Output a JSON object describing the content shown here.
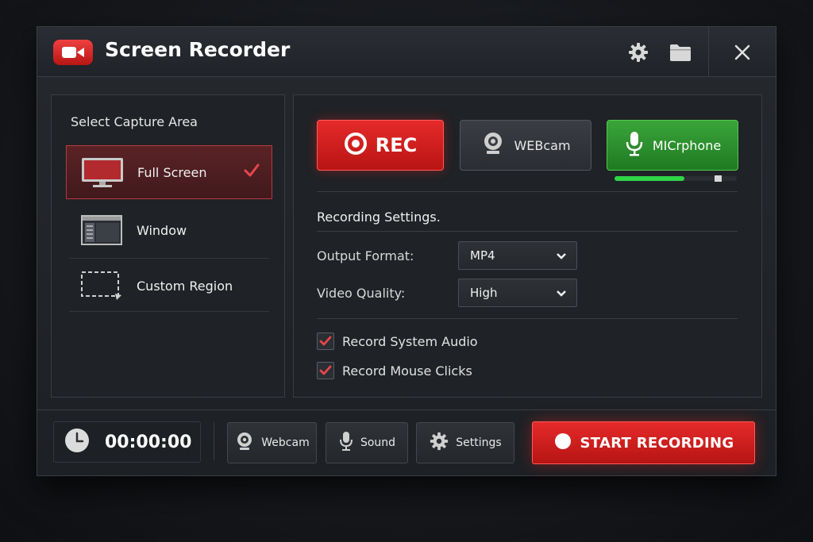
{
  "window": {
    "title": "Screen Recorder"
  },
  "colors": {
    "accent_red": "#d61f1f",
    "accent_green": "#2e9a33",
    "panel_bg": "#1f2226"
  },
  "titlebar": {
    "icons": [
      "video-camera-icon",
      "gear-icon",
      "folder-icon",
      "close-icon"
    ]
  },
  "capture": {
    "title": "Select Capture Area",
    "items": [
      {
        "label": "Full Screen",
        "icon": "monitor-icon",
        "selected": true
      },
      {
        "label": "Window",
        "icon": "window-icon",
        "selected": false
      },
      {
        "label": "Custom Region",
        "icon": "region-icon",
        "selected": false
      }
    ]
  },
  "sources": {
    "rec_label": "REC",
    "webcam_label": "WEBcam",
    "mic_label": "MICrphone",
    "mic_level": 0.57
  },
  "settings": {
    "title": "Recording Settings.",
    "output_format_label": "Output Format:",
    "output_format_value": "MP4",
    "video_quality_label": "Video Quality:",
    "video_quality_value": "High",
    "record_system_audio_label": "Record System Audio",
    "record_system_audio_checked": true,
    "record_mouse_clicks_label": "Record Mouse Clicks",
    "record_mouse_clicks_checked": true
  },
  "bottom": {
    "timer": "00:00:00",
    "webcam_label": "Webcam",
    "sound_label": "Sound",
    "settings_label": "Settings",
    "start_label": "START RECORDING"
  }
}
